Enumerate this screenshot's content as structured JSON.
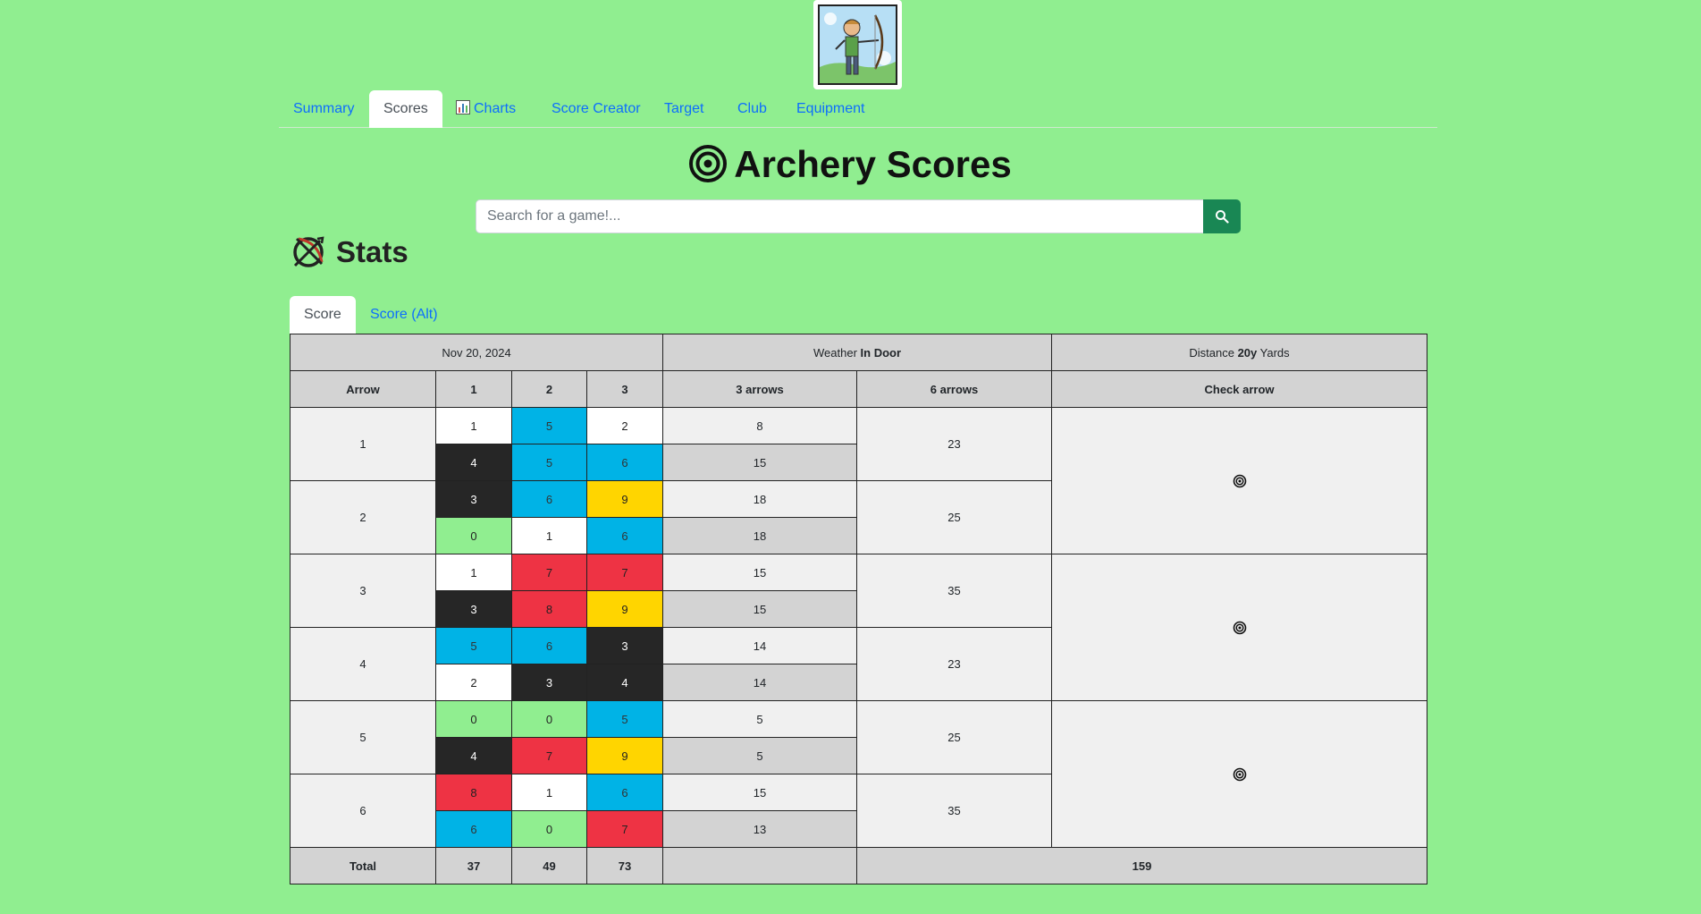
{
  "nav": {
    "tabs": [
      "Summary",
      "Scores",
      "Charts",
      "Score Creator",
      "Target",
      "Club",
      "Equipment"
    ],
    "active": "Scores"
  },
  "page": {
    "title": "Archery Scores"
  },
  "search": {
    "placeholder": "Search for a game!..."
  },
  "stats": {
    "heading": "Stats"
  },
  "subtabs": [
    "Score",
    "Score (Alt)"
  ],
  "table": {
    "date": "Nov 20, 2024",
    "weather_label": "Weather",
    "weather_value": "In Door",
    "distance_label": "Distance",
    "distance_value": "20y",
    "distance_unit": "Yards",
    "columns": [
      "Arrow",
      "1",
      "2",
      "3",
      "3 arrows",
      "6 arrows",
      "Check arrow"
    ],
    "ends": [
      {
        "label": "1",
        "six": "23",
        "rows": [
          {
            "arrows": [
              {
                "v": "1",
                "c": "white"
              },
              {
                "v": "5",
                "c": "blue"
              },
              {
                "v": "2",
                "c": "white"
              }
            ],
            "three": "8"
          },
          {
            "arrows": [
              {
                "v": "4",
                "c": "black"
              },
              {
                "v": "5",
                "c": "blue"
              },
              {
                "v": "6",
                "c": "blue"
              }
            ],
            "three": "15"
          }
        ]
      },
      {
        "label": "2",
        "six": "25",
        "rows": [
          {
            "arrows": [
              {
                "v": "3",
                "c": "black"
              },
              {
                "v": "6",
                "c": "blue"
              },
              {
                "v": "9",
                "c": "yellow"
              }
            ],
            "three": "18"
          },
          {
            "arrows": [
              {
                "v": "0",
                "c": "green"
              },
              {
                "v": "1",
                "c": "white"
              },
              {
                "v": "6",
                "c": "blue"
              }
            ],
            "three": "18"
          }
        ]
      },
      {
        "label": "3",
        "six": "35",
        "rows": [
          {
            "arrows": [
              {
                "v": "1",
                "c": "white"
              },
              {
                "v": "7",
                "c": "red"
              },
              {
                "v": "7",
                "c": "red"
              }
            ],
            "three": "15"
          },
          {
            "arrows": [
              {
                "v": "3",
                "c": "black"
              },
              {
                "v": "8",
                "c": "red"
              },
              {
                "v": "9",
                "c": "yellow"
              }
            ],
            "three": "15"
          }
        ]
      },
      {
        "label": "4",
        "six": "23",
        "rows": [
          {
            "arrows": [
              {
                "v": "5",
                "c": "blue"
              },
              {
                "v": "6",
                "c": "blue"
              },
              {
                "v": "3",
                "c": "black"
              }
            ],
            "three": "14"
          },
          {
            "arrows": [
              {
                "v": "2",
                "c": "white"
              },
              {
                "v": "3",
                "c": "black"
              },
              {
                "v": "4",
                "c": "black"
              }
            ],
            "three": "14"
          }
        ]
      },
      {
        "label": "5",
        "six": "25",
        "rows": [
          {
            "arrows": [
              {
                "v": "0",
                "c": "green"
              },
              {
                "v": "0",
                "c": "green"
              },
              {
                "v": "5",
                "c": "blue"
              }
            ],
            "three": "5"
          },
          {
            "arrows": [
              {
                "v": "4",
                "c": "black"
              },
              {
                "v": "7",
                "c": "red"
              },
              {
                "v": "9",
                "c": "yellow"
              }
            ],
            "three": "5"
          }
        ]
      },
      {
        "label": "6",
        "six": "35",
        "rows": [
          {
            "arrows": [
              {
                "v": "8",
                "c": "red"
              },
              {
                "v": "1",
                "c": "white"
              },
              {
                "v": "6",
                "c": "blue"
              }
            ],
            "three": "15"
          },
          {
            "arrows": [
              {
                "v": "6",
                "c": "blue"
              },
              {
                "v": "0",
                "c": "green"
              },
              {
                "v": "7",
                "c": "red"
              }
            ],
            "three": "13"
          }
        ]
      }
    ],
    "total": {
      "label": "Total",
      "col1": "37",
      "col2": "49",
      "col3": "73",
      "grand": "159"
    }
  },
  "colors": {
    "background": "#90ee90",
    "link": "#0d6efd",
    "search_button": "#198754"
  },
  "icons": {
    "logo": "archer-logo",
    "title": "target-icon",
    "search": "search-icon",
    "stats": "crossed-bow-icon",
    "charts": "bar-chart-icon",
    "check": "target-icon"
  }
}
